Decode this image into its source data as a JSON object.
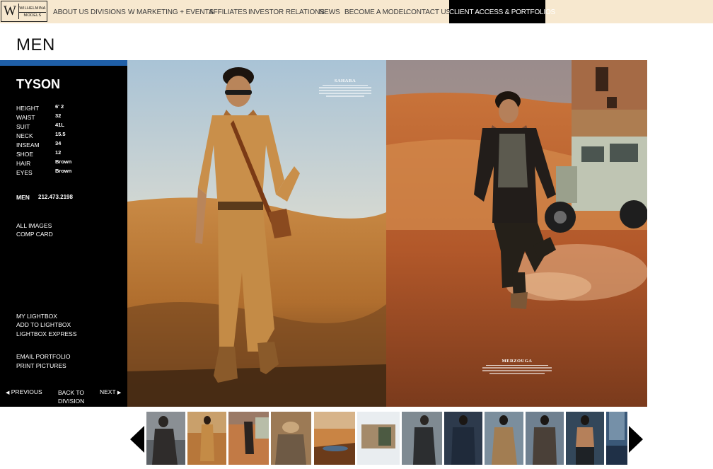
{
  "nav": {
    "logo_letter": "W",
    "logo_line1": "WILHELMINA",
    "logo_line2": "MODELS",
    "items": [
      "ABOUT US",
      "DIVISIONS",
      "W MARKETING + EVENTS",
      "AFFILIATES",
      "INVESTOR RELATIONS",
      "NEWS",
      "BECOME A MODEL",
      "CONTACT US"
    ],
    "client_access": "CLIENT ACCESS & PORTFOLIOS"
  },
  "page_title": "MEN",
  "model": {
    "name": "TYSON",
    "stats": [
      {
        "label": "HEIGHT",
        "value": "6' 2"
      },
      {
        "label": "WAIST",
        "value": "32"
      },
      {
        "label": "SUIT",
        "value": "41L"
      },
      {
        "label": "NECK",
        "value": "15.5"
      },
      {
        "label": "INSEAM",
        "value": "34"
      },
      {
        "label": "SHOE",
        "value": "12"
      },
      {
        "label": "HAIR",
        "value": "Brown"
      },
      {
        "label": "EYES",
        "value": "Brown"
      }
    ],
    "division": "MEN",
    "phone": "212.473.2198"
  },
  "sidebar_links": {
    "all_images": "ALL IMAGES",
    "comp_card": "COMP CARD",
    "my_lightbox": "MY LIGHTBOX",
    "add_to_lightbox": "ADD TO LIGHTBOX",
    "lightbox_express": "LIGHTBOX EXPRESS",
    "email_portfolio": "EMAIL PORTFOLIO",
    "print_pictures": "PRINT PICTURES",
    "previous": "PREVIOUS",
    "back_line1": "BACK TO",
    "back_line2": "DIVISION",
    "next": "NEXT"
  },
  "spread": {
    "left_caption": "SAHARA",
    "right_caption": "MERZOUGA"
  },
  "icons": {
    "prev": "triangle-left",
    "next": "triangle-right",
    "strip_prev": "large-triangle-left",
    "strip_next": "large-triangle-right"
  },
  "colors": {
    "nav_bg": "#f7e8cf",
    "sidebar_bg": "#000000",
    "accent_stripe": "#1f5fa8"
  }
}
